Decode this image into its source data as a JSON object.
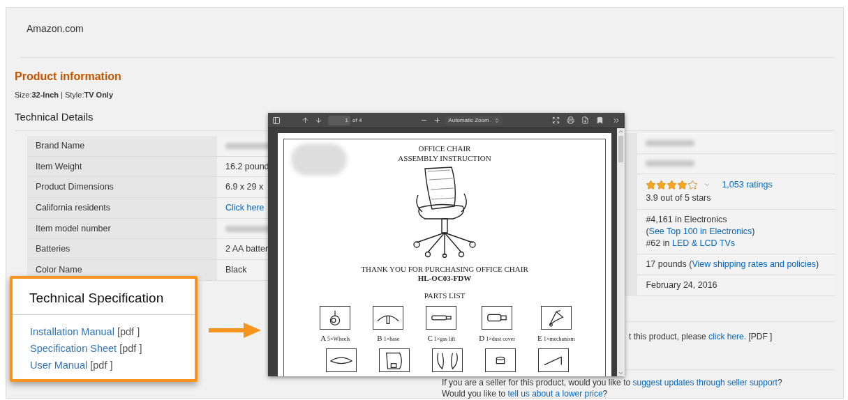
{
  "site_title": "Amazon.com",
  "section_title": "Product information",
  "variation": "Size:**32-Inch** | Style:**TV Only**",
  "details_title": "Technical Details",
  "details_left": [
    {
      "label": "Brand Name",
      "kind": "blurred"
    },
    {
      "label": "Item Weight",
      "kind": "text",
      "text": "16.2 pound"
    },
    {
      "label": "Product Dimensions",
      "kind": "text",
      "text": "6.9 x 29 x"
    },
    {
      "label": "California residents",
      "kind": "link",
      "link": "Click here"
    },
    {
      "label": "Item model number",
      "kind": "blurred"
    },
    {
      "label": "Batteries",
      "kind": "text",
      "text": "2 AA batter"
    },
    {
      "label": "Color Name",
      "kind": "text",
      "text": "Black"
    }
  ],
  "details_right": [
    {
      "kind": "blurred"
    },
    {
      "kind": "blurred"
    },
    {
      "kind": "rating",
      "stars": 4,
      "link": "1,053 ratings",
      "caption": "3.9 out of 5 stars"
    },
    {
      "kind": "lines",
      "lines": [
        {
          "text": "#4,161 in Electronics (",
          "link": "See Top 100 in Electronics",
          "after": ")"
        },
        {
          "text": "#62 in ",
          "link": "LED & LCD TVs"
        }
      ]
    },
    {
      "kind": "lines",
      "lines": [
        {
          "text": "17 pounds (",
          "link": "View shipping rates and policies",
          "after": ")"
        }
      ]
    },
    {
      "kind": "lines",
      "lines": [
        {
          "text": "February 24, 2016"
        }
      ]
    }
  ],
  "feedback": {
    "text": "t this product, please ",
    "link": "click here.",
    "after": " [PDF ]"
  },
  "seller_lines": [
    {
      "text": "If you are a seller for this product, would you like to ",
      "link": "suggest updates through seller support",
      "after": "?"
    },
    {
      "text": "Would you like to ",
      "link": "tell us about a lower price",
      "after": "?"
    }
  ],
  "callout": {
    "title": "Technical Specification",
    "documents": [
      {
        "link": "Installation Manual",
        "suffix": "[pdf ]"
      },
      {
        "link": "Specification Sheet",
        "suffix": "[pdf ]"
      },
      {
        "link": "User Manual",
        "suffix": "[pdf ]"
      }
    ]
  },
  "pdf_viewer": {
    "page_input": "1",
    "page_count": "of 4",
    "zoom": "Automatic Zoom",
    "document": {
      "title_lines": [
        "OFFICE CHAIR",
        "ASSEMBLY INSTRUCTION"
      ],
      "thanks": "THANK YOU FOR PURCHASING OFFICE CHAIR",
      "model": "HL-OC03-FDW",
      "parts_title": "PARTS LIST",
      "parts": [
        {
          "kind": "wheel",
          "letter": "A",
          "label": "5×Wheels"
        },
        {
          "kind": "base",
          "letter": "B",
          "label": "1×base"
        },
        {
          "kind": "gaslift",
          "letter": "C",
          "label": "1×gas lift"
        },
        {
          "kind": "cover",
          "letter": "D",
          "label": "1×dust cover"
        },
        {
          "kind": "mechanism",
          "letter": "E",
          "label": "1×mechanism"
        }
      ]
    }
  }
}
